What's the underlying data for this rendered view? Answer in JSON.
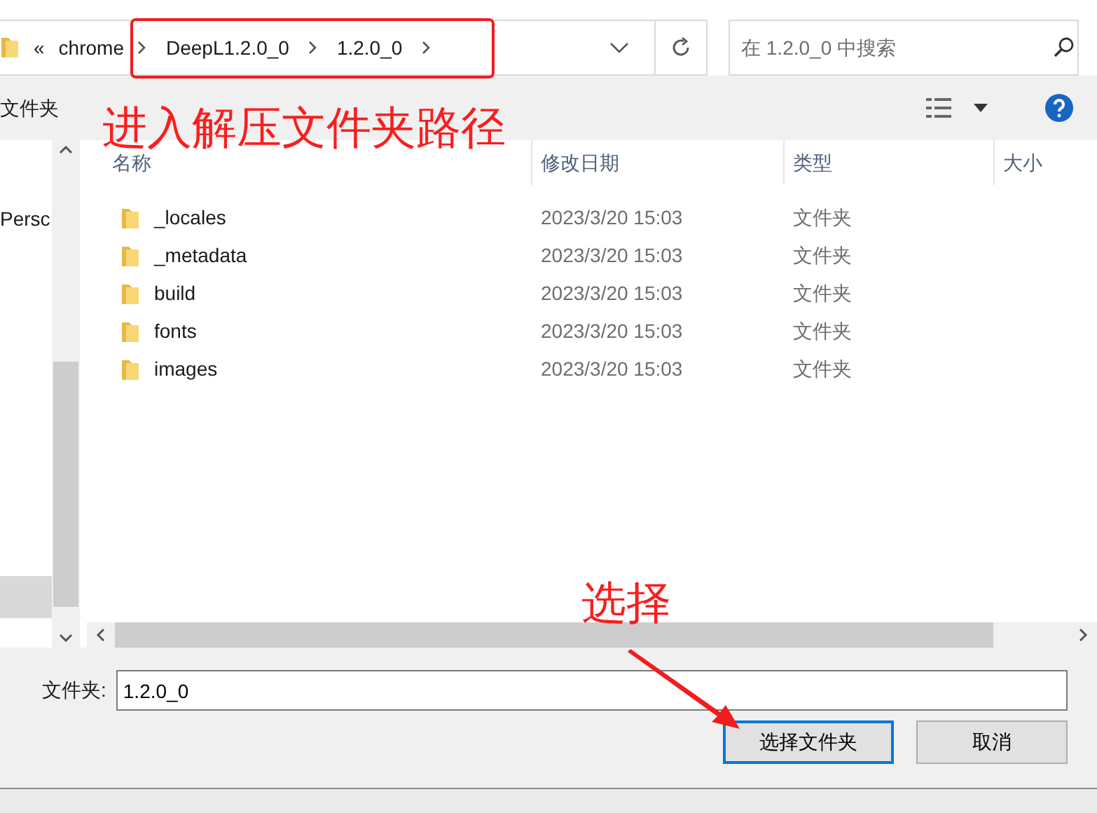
{
  "address_bar": {
    "overflow": "«",
    "breadcrumbs": [
      "chrome",
      "DeepL1.2.0_0",
      "1.2.0_0"
    ]
  },
  "search": {
    "placeholder": "在 1.2.0_0 中搜索"
  },
  "toolbar": {
    "label": "文件夹"
  },
  "annotations": [
    {
      "text": "进入解压文件夹路径"
    },
    {
      "text": "选择"
    }
  ],
  "sidebar": {
    "items": [
      {
        "label": "Persc",
        "selected": false
      },
      {
        "selected": true
      }
    ]
  },
  "table": {
    "columns": [
      "名称",
      "修改日期",
      "类型",
      "大小"
    ],
    "rows": [
      {
        "name": "_locales",
        "modified": "2023/3/20 15:03",
        "type": "文件夹"
      },
      {
        "name": "_metadata",
        "modified": "2023/3/20 15:03",
        "type": "文件夹"
      },
      {
        "name": "build",
        "modified": "2023/3/20 15:03",
        "type": "文件夹"
      },
      {
        "name": "fonts",
        "modified": "2023/3/20 15:03",
        "type": "文件夹"
      },
      {
        "name": "images",
        "modified": "2023/3/20 15:03",
        "type": "文件夹"
      }
    ]
  },
  "folder_field": {
    "label": "文件夹:",
    "value": "1.2.0_0"
  },
  "buttons": [
    {
      "label": "选择文件夹",
      "kind": "default"
    },
    {
      "label": "取消",
      "kind": "normal"
    }
  ]
}
